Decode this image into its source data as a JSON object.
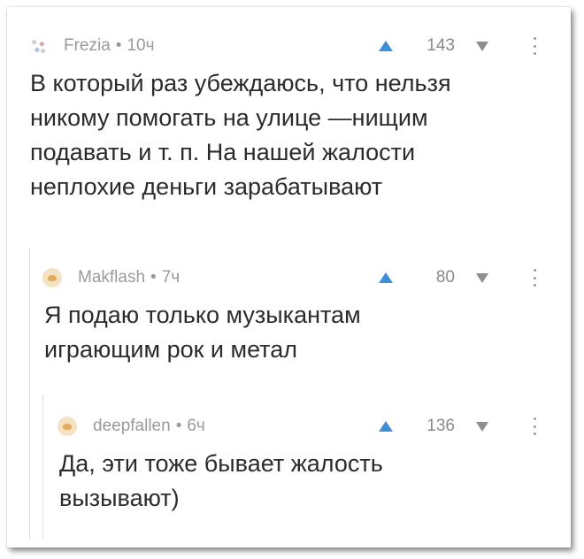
{
  "comments": [
    {
      "author": "Frezia",
      "separator": "•",
      "time": "10ч",
      "avatar_icon": "dots-avatar",
      "rating": "143",
      "text": "В который раз убеждаюсь, что нельзя\nникому помогать на улице —нищим\nподавать и т. п. На нашей жалости\nнеплохие деньги зарабатывают"
    },
    {
      "author": "Makflash",
      "separator": "•",
      "time": "7ч",
      "avatar_icon": "cat-avatar",
      "rating": "80",
      "text": "Я подаю только музыкантам\nиграющим рок и метал"
    },
    {
      "author": "deepfallen",
      "separator": "•",
      "time": "6ч",
      "avatar_icon": "cat-avatar",
      "rating": "136",
      "text": "Да, эти тоже бывает жалость\nвызывают)"
    }
  ],
  "colors": {
    "upvote": "#3f8ed8",
    "downvote": "#8e8e8e",
    "meta": "#9a9a9a",
    "text": "#2b2b2b",
    "thread_line": "#dcdcdc"
  }
}
